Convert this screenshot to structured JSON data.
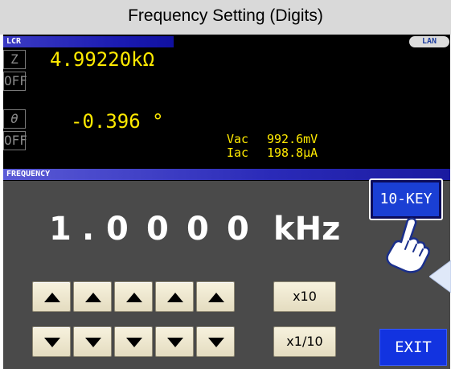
{
  "window": {
    "title": "Frequency Setting (Digits)"
  },
  "lcr": {
    "header": "LCR",
    "lan_badge": "LAN",
    "side_buttons": [
      "Z",
      "OFF",
      "θ",
      "OFF"
    ],
    "primary_value": "4.99220kΩ",
    "secondary_value": "-0.396 °",
    "vac_label": "Vac",
    "vac_value": "992.6mV",
    "iac_label": "Iac",
    "iac_value": "198.8μA"
  },
  "frequency": {
    "header": "FREQUENCY",
    "digits": [
      "1",
      ".",
      "0",
      "0",
      "0",
      "0"
    ],
    "unit": "kHz",
    "multiply_label": "x10",
    "divide_label": "x1/10"
  },
  "buttons": {
    "tenkey_label": "10-KEY",
    "exit_label": "EXIT"
  },
  "colors": {
    "value_yellow": "#ffea00",
    "key_blue": "#1a3fd4",
    "panel_gray": "#4a4a4a"
  }
}
